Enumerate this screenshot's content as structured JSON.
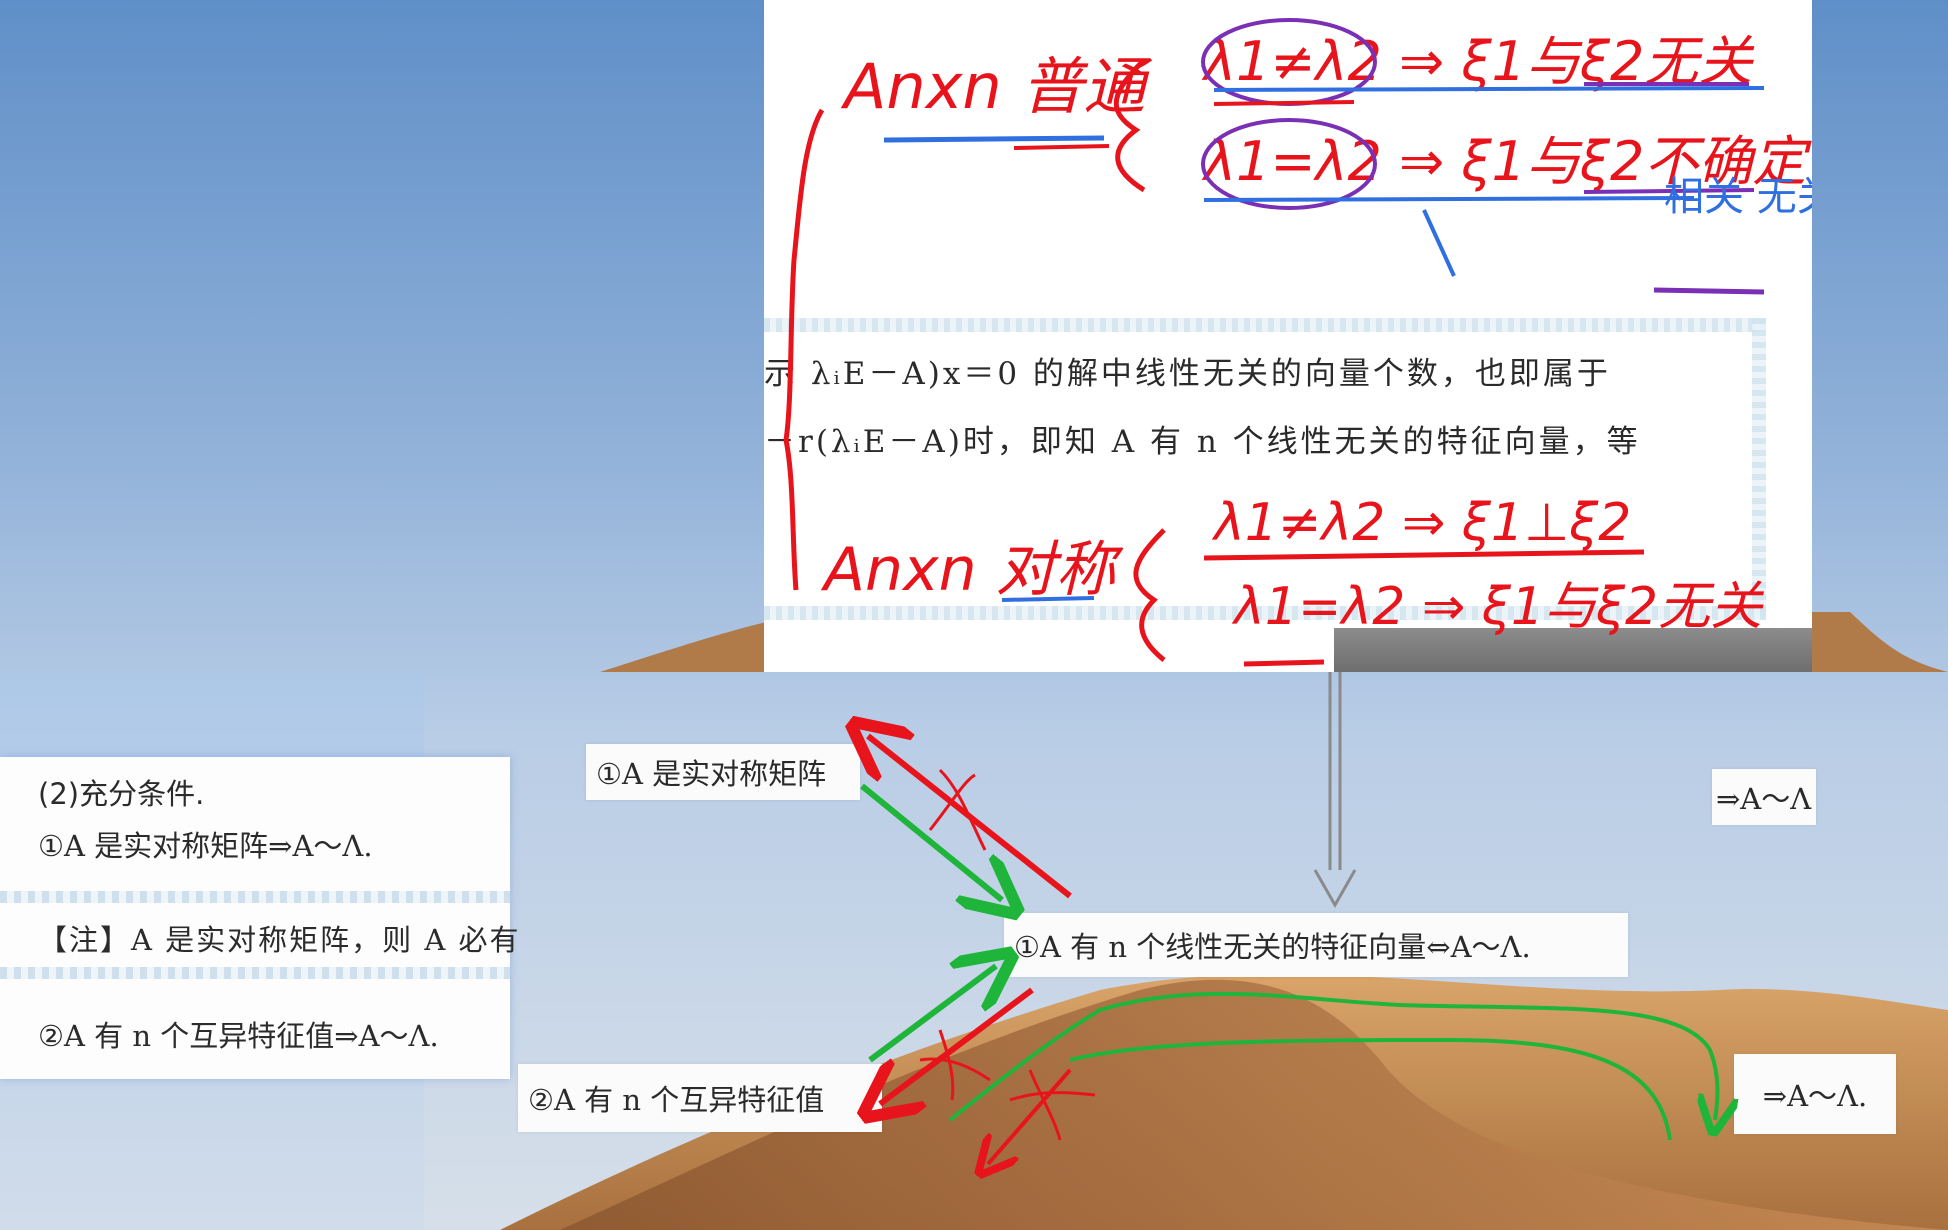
{
  "top_panel": {
    "book_line_1": "示 λᵢE－A)x＝0 的解中线性无关的向量个数，也即属于",
    "book_line_2": "－r(λᵢE－A)时，即知 A 有 n 个线性无关的特征向量，等",
    "handwriting": {
      "general_title": "Anxn 普通",
      "general_case_1": "λ1≠λ2 ⇒ ξ1与ξ2无关",
      "general_case_2": "λ1=λ2 ⇒ ξ1与ξ2不确定",
      "general_note": "相关 无关",
      "symmetric_title": "Anxn 对称",
      "symmetric_case_1": "λ1≠λ2 ⇒ ξ1⊥ξ2",
      "symmetric_case_2": "λ1=λ2 ⇒ ξ1与ξ2无关"
    }
  },
  "left_panel": {
    "heading": "(2)充分条件.",
    "item_1": "①A 是实对称矩阵⇒A～Λ.",
    "note": "【注】A 是实对称矩阵，则 A 必有",
    "item_2": "②A 有 n 个互异特征值⇒A～Λ."
  },
  "cards": {
    "symmetric": "①A 是实对称矩阵",
    "theorem": "①A 有 n 个线性无关的特征向量⇔A～Λ.",
    "distinct": "②A 有 n 个互异特征值",
    "right_top": "⇒A～Λ",
    "right_bottom": "⇒A～Λ."
  },
  "colors": {
    "ink_red": "#e8141c",
    "ink_blue": "#2f6fe0",
    "ink_purple": "#7a2fb5",
    "ink_green": "#1fb53a",
    "arrow_gray": "#8a8a8a"
  }
}
